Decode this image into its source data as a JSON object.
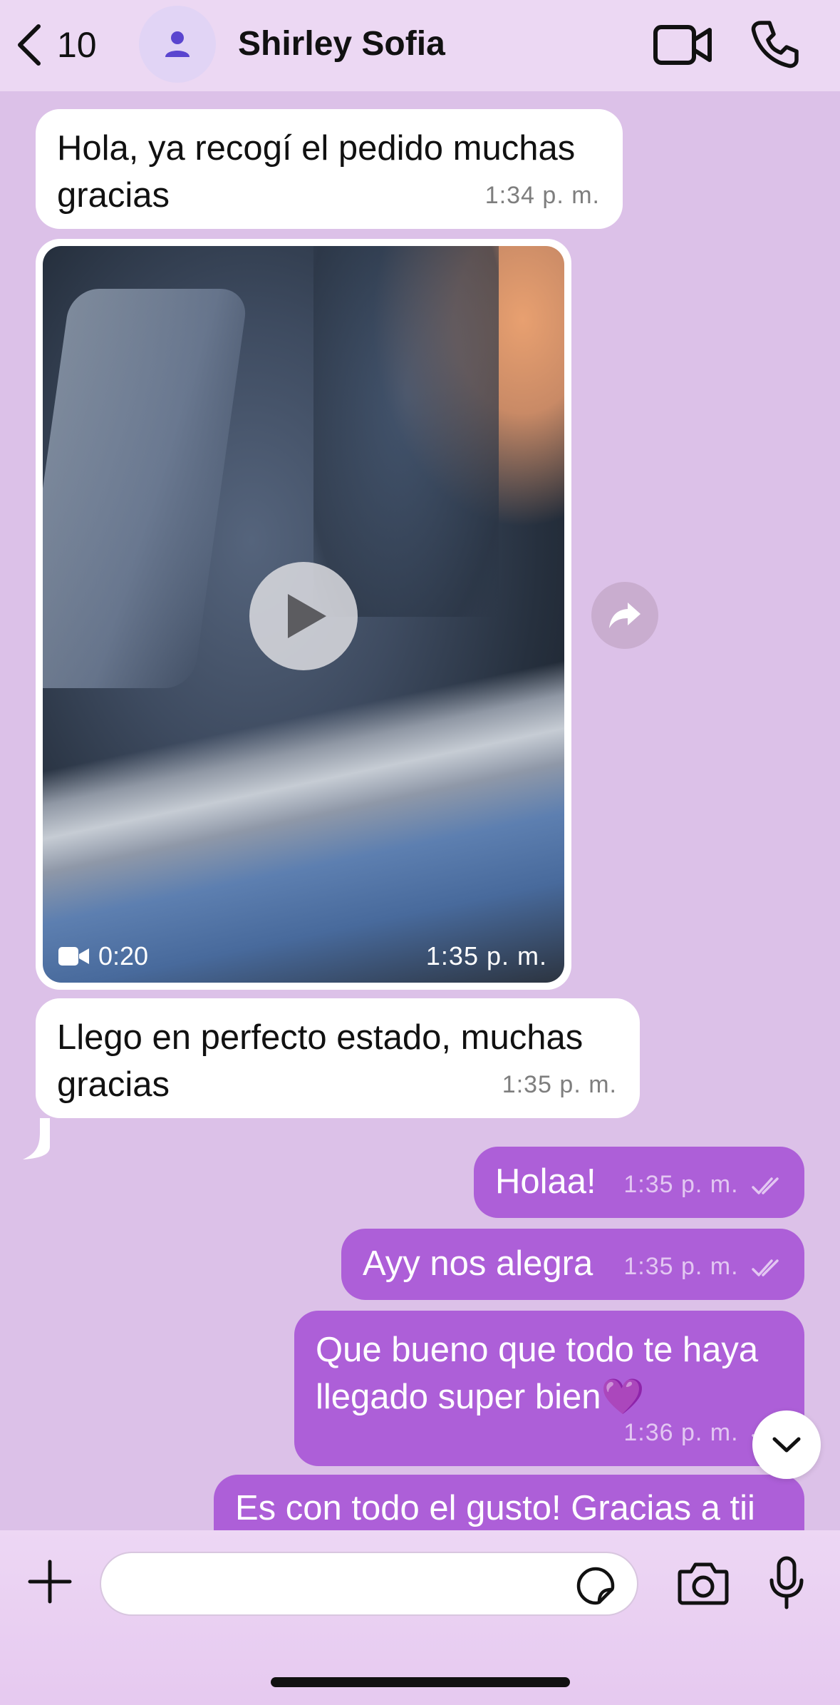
{
  "header": {
    "back_count": "10",
    "contact_name": "Shirley Sofia"
  },
  "messages": [
    {
      "dir": "in",
      "text": "Hola, ya recogí el pedido muchas gracias",
      "time": "1:34 p. m."
    },
    {
      "dir": "in",
      "type": "video",
      "duration": "0:20",
      "time": "1:35 p. m."
    },
    {
      "dir": "in",
      "text": "Llego en perfecto estado, muchas gracias",
      "time": "1:35 p. m."
    },
    {
      "dir": "out",
      "text": "Holaa!",
      "time": "1:35 p. m."
    },
    {
      "dir": "out",
      "text": "Ayy nos alegra",
      "time": "1:35 p. m."
    },
    {
      "dir": "out",
      "text": "Que bueno que todo te haya llegado super bien💜",
      "time": "1:36 p. m."
    },
    {
      "dir": "out",
      "text": "Es con todo el gusto! Gracias a tii",
      "time": ""
    }
  ],
  "composer": {
    "placeholder": ""
  },
  "colors": {
    "chat_bg": "#dcc1e8",
    "header_bg": "#ecd8f3",
    "outgoing_bubble": "#ad5fd8",
    "incoming_bubble": "#ffffff"
  },
  "icons": {
    "back": "chevron-left-icon",
    "avatar": "person-icon",
    "video_call": "video-camera-icon",
    "voice_call": "phone-icon",
    "play": "play-icon",
    "forward": "forward-arrow-icon",
    "scroll_down": "chevron-down-icon",
    "attach": "plus-icon",
    "sticker": "sticker-icon",
    "camera": "camera-icon",
    "mic": "microphone-icon",
    "read_receipt": "double-check-icon"
  }
}
